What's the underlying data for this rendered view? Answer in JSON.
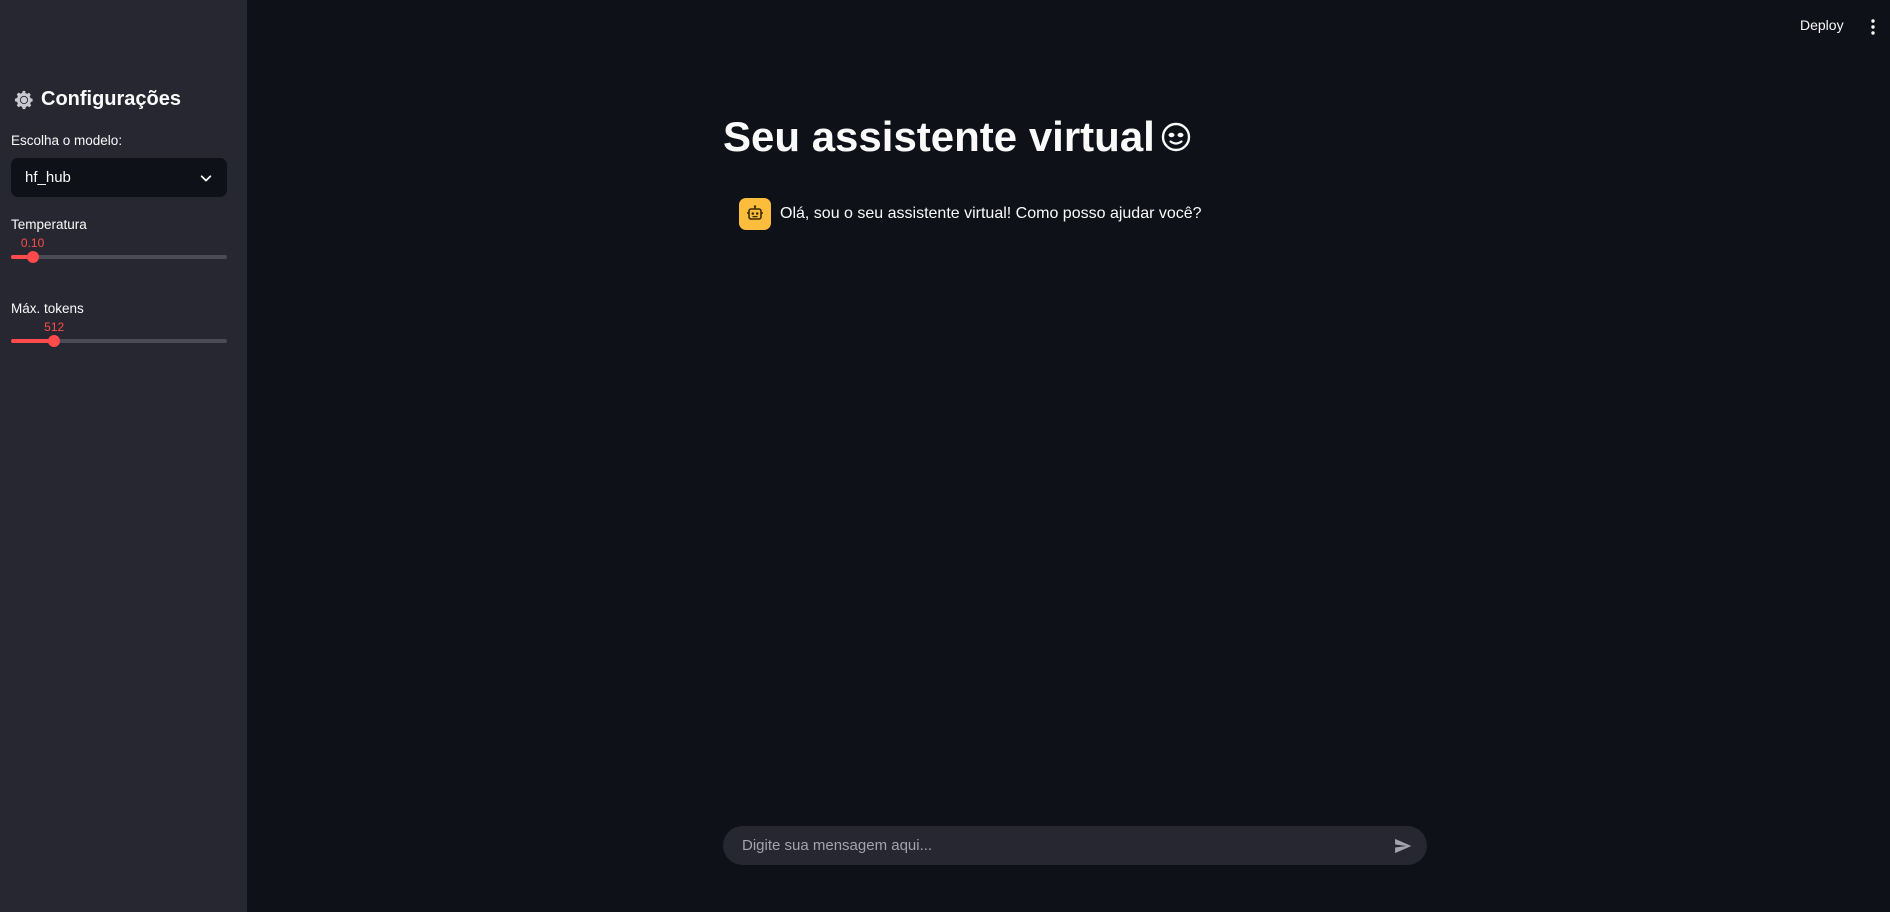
{
  "header": {
    "deploy_label": "Deploy",
    "menu_icon": "kebab-menu-icon"
  },
  "sidebar": {
    "title": "Configurações",
    "title_icon": "gear-icon",
    "model_select": {
      "label": "Escolha o modelo:",
      "value": "hf_hub"
    },
    "temperature": {
      "label": "Temperatura",
      "value_text": "0.10",
      "fraction": 0.1
    },
    "max_tokens": {
      "label": "Máx. tokens",
      "value_text": "512",
      "fraction": 0.2
    }
  },
  "main": {
    "title": "Seu assistente virtual",
    "title_icon": "face-emoji-icon",
    "messages": [
      {
        "role": "assistant",
        "avatar_icon": "robot-icon",
        "text": "Olá, sou o seu assistente virtual! Como posso ajudar você?"
      }
    ],
    "input": {
      "placeholder": "Digite sua mensagem aqui...",
      "value": ""
    }
  },
  "colors": {
    "background": "#0e1117",
    "sidebar": "#262730",
    "accent": "#ff4b4b",
    "avatar": "#fdbd3c"
  }
}
